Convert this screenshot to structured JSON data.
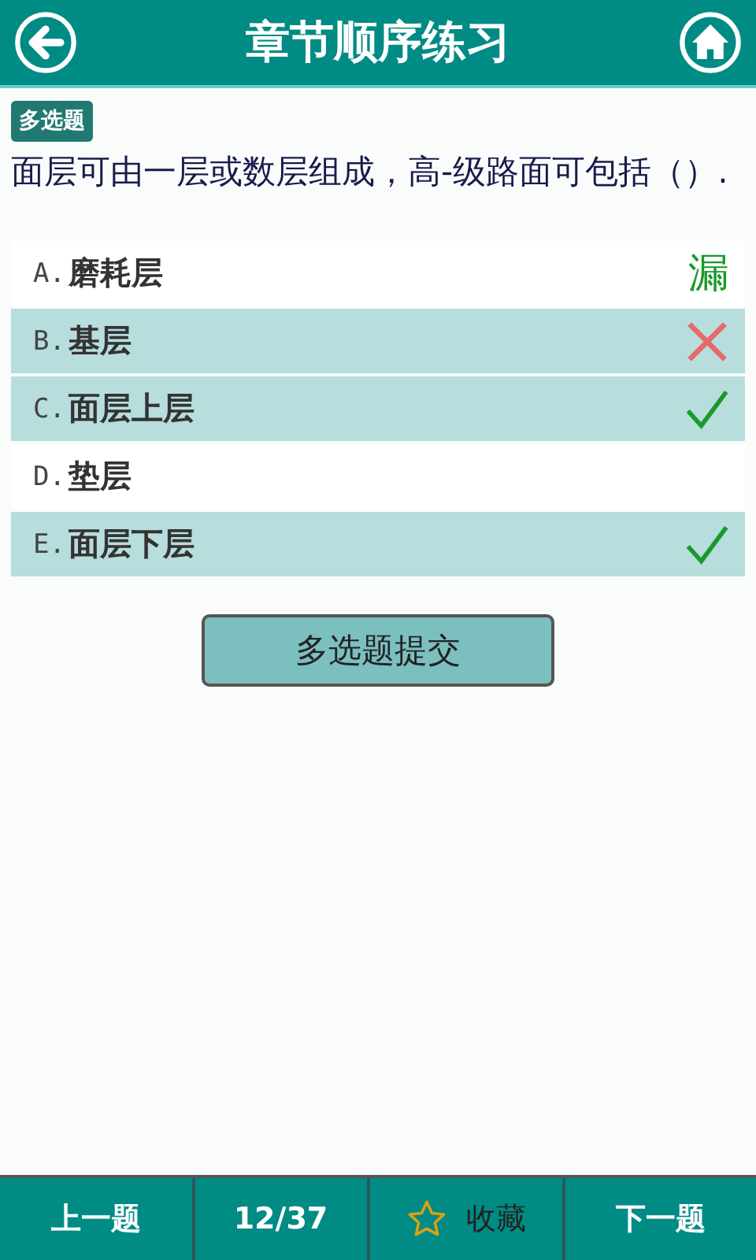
{
  "header": {
    "title": "章节顺序练习"
  },
  "question": {
    "type_badge": "多选题",
    "text": "面层可由一层或数层组成，高-级路面可包括（）."
  },
  "options": [
    {
      "letter": "A.",
      "text": "磨耗层",
      "selected": false,
      "result": {
        "kind": "missed",
        "text": "漏"
      }
    },
    {
      "letter": "B.",
      "text": "基层",
      "selected": true,
      "result": {
        "kind": "wrong"
      }
    },
    {
      "letter": "C.",
      "text": "面层上层",
      "selected": true,
      "result": {
        "kind": "correct"
      }
    },
    {
      "letter": "D.",
      "text": "垫层",
      "selected": false
    },
    {
      "letter": "E.",
      "text": "面层下层",
      "selected": true,
      "result": {
        "kind": "correct"
      }
    }
  ],
  "submit_button": "多选题提交",
  "bottom_bar": {
    "previous": "上一题",
    "progress": "12/37",
    "favorite": "收藏",
    "next": "下一题"
  }
}
